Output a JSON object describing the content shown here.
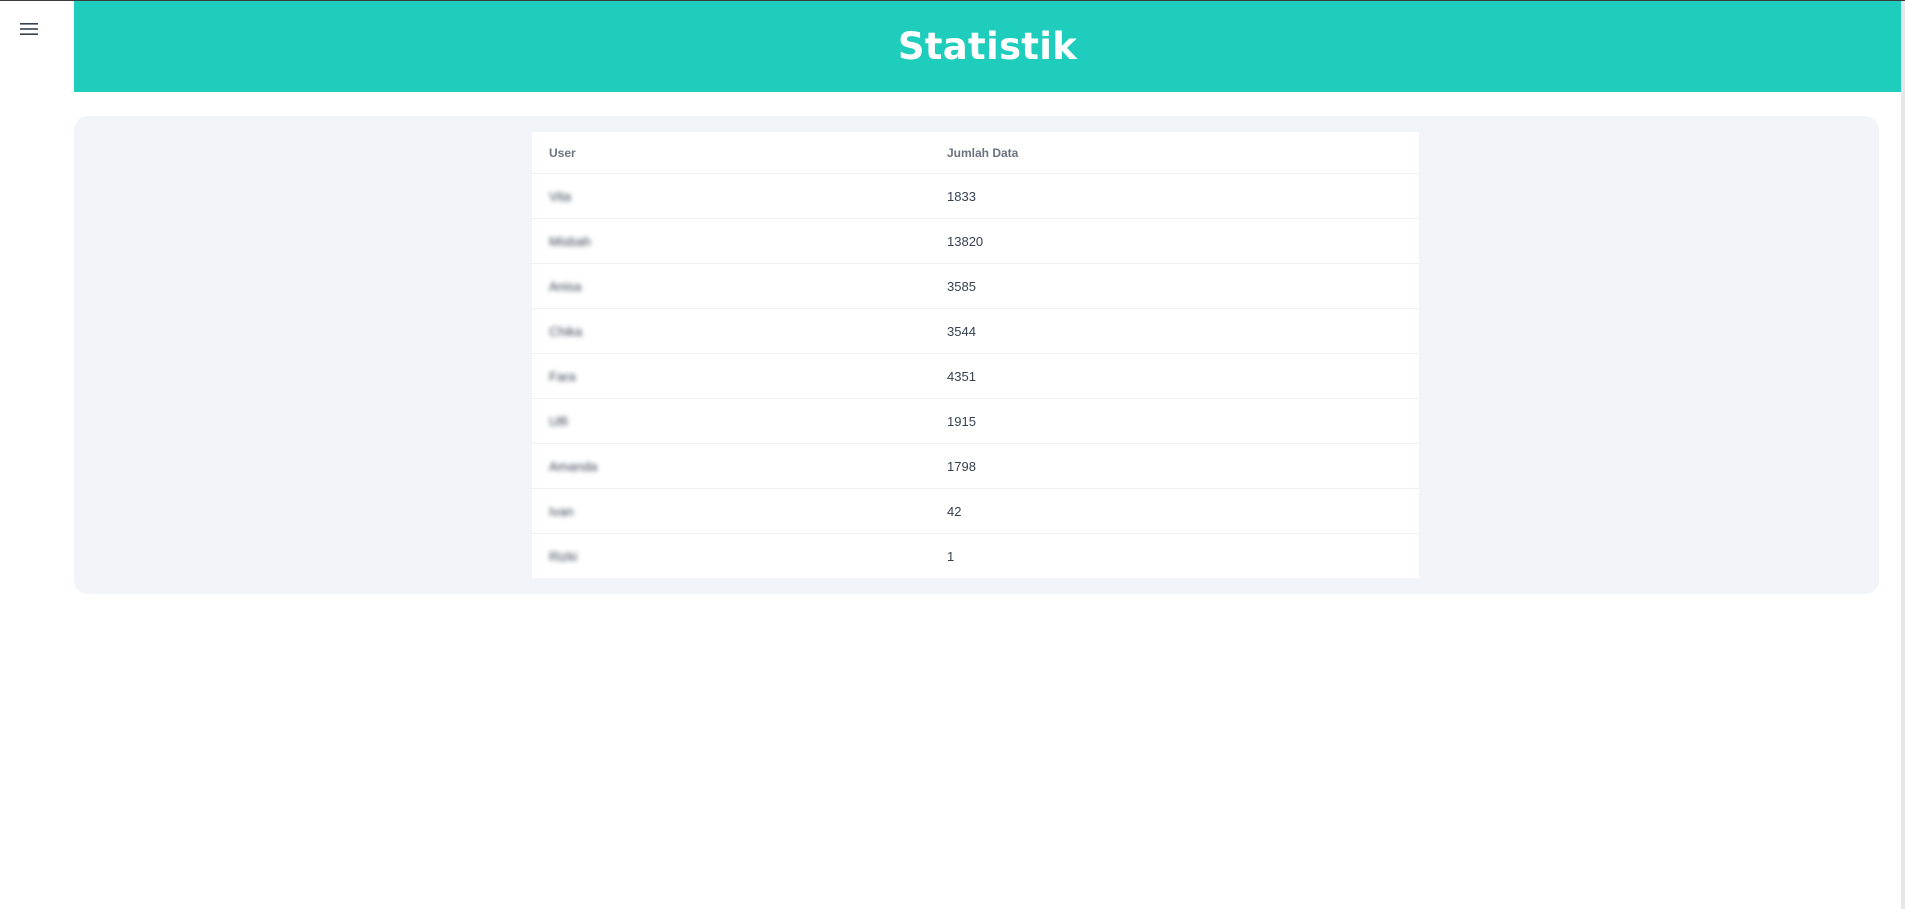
{
  "header": {
    "title": "Statistik",
    "background_color": "#1ecdbb"
  },
  "menu": {
    "icon": "hamburger-menu-icon"
  },
  "table": {
    "columns": [
      "User",
      "Jumlah Data"
    ],
    "rows": [
      {
        "user": "Vita",
        "count": "1833"
      },
      {
        "user": "Misbah",
        "count": "13820"
      },
      {
        "user": "Anisa",
        "count": "3585"
      },
      {
        "user": "Chika",
        "count": "3544"
      },
      {
        "user": "Fara",
        "count": "4351"
      },
      {
        "user": "Ulfi",
        "count": "1915"
      },
      {
        "user": "Amanda",
        "count": "1798"
      },
      {
        "user": "Ivan",
        "count": "42"
      },
      {
        "user": "Rizki",
        "count": "1"
      }
    ]
  },
  "colors": {
    "panel_background": "#f1f4f8",
    "table_background": "#ffffff",
    "text": "#374151",
    "header_text": "#6b7280"
  }
}
